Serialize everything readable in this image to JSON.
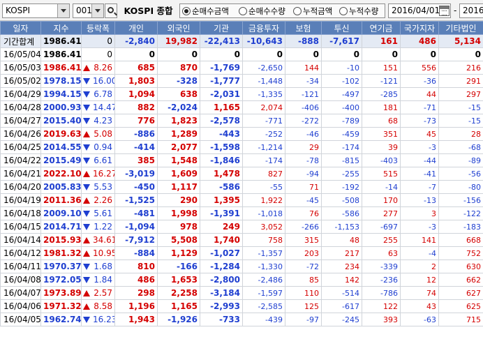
{
  "toolbar": {
    "market_value": "KOSPI",
    "code_value": "001",
    "index_name": "KOSPI 종합",
    "radios": [
      {
        "label": "순매수금액",
        "selected": true
      },
      {
        "label": "순매수수량",
        "selected": false
      },
      {
        "label": "누적금액",
        "selected": false
      },
      {
        "label": "누적수량",
        "selected": false
      }
    ],
    "start_date": "2016/04/01",
    "separator": "-",
    "end_date": "2016/"
  },
  "table": {
    "headers": [
      "일자",
      "지수",
      "등락폭",
      "개인",
      "외국인",
      "기관",
      "금융투자",
      "보험",
      "투신",
      "연기금",
      "국가지자",
      "기타법인"
    ],
    "rows": [
      {
        "date": "기간합계",
        "index": "1986.41",
        "dir": "",
        "change": "0",
        "individual": "-2,840",
        "foreign": "19,982",
        "institution": "-22,413",
        "fin": "-10,643",
        "insurance": "-888",
        "trust": "-7,617",
        "pension": "161",
        "govt": "486",
        "other": "5,134"
      },
      {
        "date": "16/05/04",
        "index": "1986.41",
        "dir": "",
        "change": "0",
        "individual": "0",
        "foreign": "0",
        "institution": "0",
        "fin": "0",
        "insurance": "0",
        "trust": "0",
        "pension": "0",
        "govt": "0",
        "other": "0"
      },
      {
        "date": "16/05/03",
        "index": "1986.41",
        "dir": "up",
        "change": "8.26",
        "individual": "685",
        "foreign": "870",
        "institution": "-1,769",
        "fin": "-2,650",
        "insurance": "144",
        "trust": "-10",
        "pension": "151",
        "govt": "556",
        "other": "216"
      },
      {
        "date": "16/05/02",
        "index": "1978.15",
        "dir": "dn",
        "change": "16.00",
        "individual": "1,803",
        "foreign": "-328",
        "institution": "-1,777",
        "fin": "-1,448",
        "insurance": "-34",
        "trust": "-102",
        "pension": "-121",
        "govt": "-36",
        "other": "291"
      },
      {
        "date": "16/04/29",
        "index": "1994.15",
        "dir": "dn",
        "change": "6.78",
        "individual": "1,094",
        "foreign": "638",
        "institution": "-2,031",
        "fin": "-1,335",
        "insurance": "-121",
        "trust": "-497",
        "pension": "-285",
        "govt": "44",
        "other": "297"
      },
      {
        "date": "16/04/28",
        "index": "2000.93",
        "dir": "dn",
        "change": "14.47",
        "individual": "882",
        "foreign": "-2,024",
        "institution": "1,165",
        "fin": "2,074",
        "insurance": "-406",
        "trust": "-400",
        "pension": "181",
        "govt": "-71",
        "other": "-15"
      },
      {
        "date": "16/04/27",
        "index": "2015.40",
        "dir": "dn",
        "change": "4.23",
        "individual": "776",
        "foreign": "1,823",
        "institution": "-2,578",
        "fin": "-771",
        "insurance": "-272",
        "trust": "-789",
        "pension": "68",
        "govt": "-73",
        "other": "-15"
      },
      {
        "date": "16/04/26",
        "index": "2019.63",
        "dir": "up",
        "change": "5.08",
        "individual": "-886",
        "foreign": "1,289",
        "institution": "-443",
        "fin": "-252",
        "insurance": "-46",
        "trust": "-459",
        "pension": "351",
        "govt": "45",
        "other": "28"
      },
      {
        "date": "16/04/25",
        "index": "2014.55",
        "dir": "dn",
        "change": "0.94",
        "individual": "-414",
        "foreign": "2,077",
        "institution": "-1,598",
        "fin": "-1,214",
        "insurance": "29",
        "trust": "-174",
        "pension": "39",
        "govt": "-3",
        "other": "-68"
      },
      {
        "date": "16/04/22",
        "index": "2015.49",
        "dir": "dn",
        "change": "6.61",
        "individual": "385",
        "foreign": "1,548",
        "institution": "-1,846",
        "fin": "-174",
        "insurance": "-78",
        "trust": "-815",
        "pension": "-403",
        "govt": "-44",
        "other": "-89"
      },
      {
        "date": "16/04/21",
        "index": "2022.10",
        "dir": "up",
        "change": "16.27",
        "individual": "-3,019",
        "foreign": "1,609",
        "institution": "1,478",
        "fin": "827",
        "insurance": "-94",
        "trust": "-255",
        "pension": "515",
        "govt": "-41",
        "other": "-56"
      },
      {
        "date": "16/04/20",
        "index": "2005.83",
        "dir": "dn",
        "change": "5.53",
        "individual": "-450",
        "foreign": "1,117",
        "institution": "-586",
        "fin": "-55",
        "insurance": "71",
        "trust": "-192",
        "pension": "-14",
        "govt": "-7",
        "other": "-80"
      },
      {
        "date": "16/04/19",
        "index": "2011.36",
        "dir": "up",
        "change": "2.26",
        "individual": "-1,525",
        "foreign": "290",
        "institution": "1,395",
        "fin": "1,922",
        "insurance": "-45",
        "trust": "-508",
        "pension": "170",
        "govt": "-13",
        "other": "-156"
      },
      {
        "date": "16/04/18",
        "index": "2009.10",
        "dir": "dn",
        "change": "5.61",
        "individual": "-481",
        "foreign": "1,998",
        "institution": "-1,391",
        "fin": "-1,018",
        "insurance": "76",
        "trust": "-586",
        "pension": "277",
        "govt": "3",
        "other": "-122"
      },
      {
        "date": "16/04/15",
        "index": "2014.71",
        "dir": "dn",
        "change": "1.22",
        "individual": "-1,094",
        "foreign": "978",
        "institution": "249",
        "fin": "3,052",
        "insurance": "-266",
        "trust": "-1,153",
        "pension": "-697",
        "govt": "-3",
        "other": "-183"
      },
      {
        "date": "16/04/14",
        "index": "2015.93",
        "dir": "up",
        "change": "34.61",
        "individual": "-7,912",
        "foreign": "5,508",
        "institution": "1,740",
        "fin": "758",
        "insurance": "315",
        "trust": "48",
        "pension": "255",
        "govt": "141",
        "other": "668"
      },
      {
        "date": "16/04/12",
        "index": "1981.32",
        "dir": "up",
        "change": "10.95",
        "individual": "-884",
        "foreign": "1,129",
        "institution": "-1,027",
        "fin": "-1,357",
        "insurance": "203",
        "trust": "217",
        "pension": "63",
        "govt": "-4",
        "other": "752"
      },
      {
        "date": "16/04/11",
        "index": "1970.37",
        "dir": "dn",
        "change": "1.68",
        "individual": "810",
        "foreign": "-166",
        "institution": "-1,284",
        "fin": "-1,330",
        "insurance": "-72",
        "trust": "234",
        "pension": "-339",
        "govt": "2",
        "other": "630"
      },
      {
        "date": "16/04/08",
        "index": "1972.05",
        "dir": "dn",
        "change": "1.84",
        "individual": "486",
        "foreign": "1,653",
        "institution": "-2,800",
        "fin": "-2,486",
        "insurance": "85",
        "trust": "142",
        "pension": "-236",
        "govt": "12",
        "other": "662"
      },
      {
        "date": "16/04/07",
        "index": "1973.89",
        "dir": "up",
        "change": "2.57",
        "individual": "298",
        "foreign": "2,258",
        "institution": "-3,184",
        "fin": "-1,597",
        "insurance": "110",
        "trust": "-514",
        "pension": "-786",
        "govt": "74",
        "other": "627"
      },
      {
        "date": "16/04/06",
        "index": "1971.32",
        "dir": "up",
        "change": "8.58",
        "individual": "1,196",
        "foreign": "1,165",
        "institution": "-2,993",
        "fin": "-2,585",
        "insurance": "125",
        "trust": "-617",
        "pension": "122",
        "govt": "43",
        "other": "625"
      },
      {
        "date": "16/04/05",
        "index": "1962.74",
        "dir": "dn",
        "change": "16.23",
        "individual": "1,943",
        "foreign": "-1,926",
        "institution": "-733",
        "fin": "-439",
        "insurance": "-97",
        "trust": "-245",
        "pension": "393",
        "govt": "-63",
        "other": "715"
      }
    ]
  },
  "icons": {
    "dropdown": "chevron-down-icon",
    "search": "search-icon",
    "calendar": "calendar-icon",
    "rise": "triangle-up-icon",
    "fall": "triangle-down-icon"
  },
  "colors": {
    "header_bg": "#5a7fb8",
    "positive": "#d40000",
    "negative": "#1f3fd0",
    "summary_bg": "#e4eaf4"
  }
}
